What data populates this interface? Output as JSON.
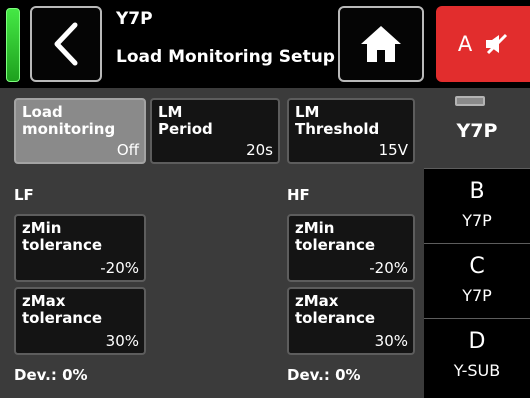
{
  "header": {
    "device": "Y7P",
    "page_title": "Load Monitoring Setup",
    "mute_label": "A",
    "icons": {
      "back": "chevron-left-icon",
      "home": "home-icon",
      "mute": "speaker-mute-icon"
    },
    "colors": {
      "status_led": "#33d633",
      "mute_bg": "#e22d2d"
    }
  },
  "top_buttons": {
    "load_monitoring": {
      "label": "Load\nmonitoring",
      "value": "Off"
    },
    "lm_period": {
      "label": "LM\nPeriod",
      "value": "20s"
    },
    "lm_threshold": {
      "label": "LM\nThreshold",
      "value": "15V"
    }
  },
  "lf": {
    "title": "LF",
    "zmin": {
      "label": "zMin\ntolerance",
      "value": "-20%"
    },
    "zmax": {
      "label": "zMax\ntolerance",
      "value": "30%"
    },
    "dev": "Dev.: 0%"
  },
  "hf": {
    "title": "HF",
    "zmin": {
      "label": "zMin\ntolerance",
      "value": "-20%"
    },
    "zmax": {
      "label": "zMax\ntolerance",
      "value": "30%"
    },
    "dev": "Dev.: 0%"
  },
  "channels": {
    "active": {
      "name": "Y7P"
    },
    "b": {
      "letter": "B",
      "name": "Y7P"
    },
    "c": {
      "letter": "C",
      "name": "Y7P"
    },
    "d": {
      "letter": "D",
      "name": "Y-SUB"
    }
  }
}
